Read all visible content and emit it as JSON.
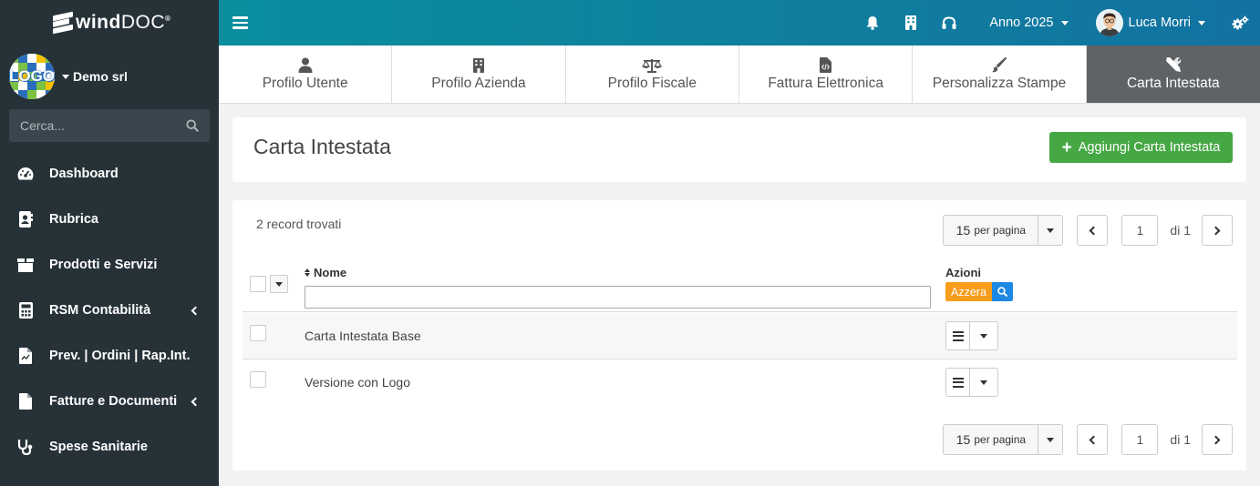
{
  "app": {
    "brand_primary": "wind",
    "brand_secondary": "DOC",
    "brand_reg": "®",
    "company_logo_text": "LOGO",
    "company_name": "Demo srl",
    "colors": {
      "sidebar_bg": "#263238",
      "topbar_start": "#0a8e9e",
      "topbar_end": "#1272a2",
      "primary_green": "#46a845",
      "reset_orange": "#f89c1c",
      "search_blue": "#1e88e5",
      "active_tab": "#5f6366"
    }
  },
  "sidebar": {
    "search_placeholder": "Cerca...",
    "items": [
      {
        "label": "Dashboard",
        "icon": "dashboard-icon"
      },
      {
        "label": "Rubrica",
        "icon": "address-book-icon"
      },
      {
        "label": "Prodotti e Servizi",
        "icon": "box-icon"
      },
      {
        "label": "RSM Contabilità",
        "icon": "calculator-icon",
        "expandable": true
      },
      {
        "label": "Prev. | Ordini | Rap.Int.",
        "icon": "file-chart-icon"
      },
      {
        "label": "Fatture e Documenti",
        "icon": "file-invoice-icon",
        "expandable": true
      },
      {
        "label": "Spese Sanitarie",
        "icon": "stethoscope-icon"
      }
    ]
  },
  "topbar": {
    "year_label": "Anno 2025",
    "user_name": "Luca Morri"
  },
  "tabs": [
    {
      "label": "Profilo Utente",
      "icon": "user-icon"
    },
    {
      "label": "Profilo Azienda",
      "icon": "building-icon"
    },
    {
      "label": "Profilo Fiscale",
      "icon": "balance-scale-icon"
    },
    {
      "label": "Fattura Elettronica",
      "icon": "file-code-icon"
    },
    {
      "label": "Personalizza Stampe",
      "icon": "paint-brush-icon"
    },
    {
      "label": "Carta Intestata",
      "icon": "tools-icon",
      "active": true
    }
  ],
  "page": {
    "title": "Carta Intestata",
    "add_button": "Aggiungi Carta Intestata"
  },
  "table": {
    "record_count": "2 record trovati",
    "per_page_value": "15",
    "per_page_suffix": "per pagina",
    "current_page": "1",
    "total_pages_label": "di 1",
    "columns": {
      "name": "Nome",
      "actions": "Azioni"
    },
    "reset_button": "Azzera",
    "rows": [
      {
        "name": "Carta Intestata Base"
      },
      {
        "name": "Versione con Logo"
      }
    ]
  }
}
